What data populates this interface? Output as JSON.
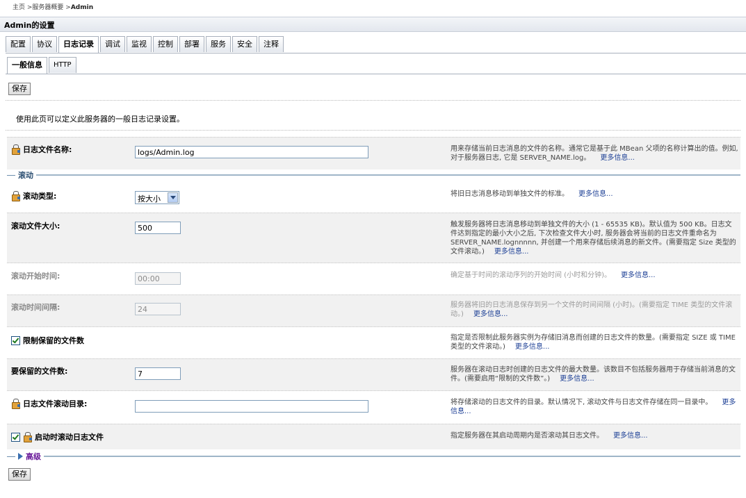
{
  "breadcrumb": {
    "home": "主页",
    "sep1": " >",
    "overview": "服务器概要",
    "sep2": " >",
    "current": "Admin"
  },
  "page_title": "Admin的设置",
  "tabs": [
    {
      "label": "配置",
      "active": false
    },
    {
      "label": "协议",
      "active": false
    },
    {
      "label": "日志记录",
      "active": true
    },
    {
      "label": "调试",
      "active": false
    },
    {
      "label": "监视",
      "active": false
    },
    {
      "label": "控制",
      "active": false
    },
    {
      "label": "部署",
      "active": false
    },
    {
      "label": "服务",
      "active": false
    },
    {
      "label": "安全",
      "active": false
    },
    {
      "label": "注释",
      "active": false
    }
  ],
  "subtabs": [
    {
      "label": "一般信息",
      "active": true
    },
    {
      "label": "HTTP",
      "active": false
    }
  ],
  "save_label": "保存",
  "intro": "使用此页可以定义此服务器的一般日志记录设置。",
  "more_info": "更多信息...",
  "fields": {
    "log_file_name": {
      "label": "日志文件名称:",
      "value": "logs/Admin.log",
      "help": "用来存储当前日志消息的文件的名称。通常它是基于此 MBean 父项的名称计算出的值。例如, 对于服务器日志, 它是 SERVER_NAME.log。"
    },
    "rotation_type": {
      "label": "滚动类型:",
      "value": "按大小",
      "help": "将旧日志消息移动到单独文件的标准。"
    },
    "rotation_file_size": {
      "label": "滚动文件大小:",
      "value": "500",
      "help": "触发服务器将日志消息移动到单独文件的大小 (1 - 65535 KB)。默认值为 500 KB。日志文件达到指定的最小大小之后, 下次检查文件大小时, 服务器会将当前的日志文件重命名为 SERVER_NAME.lognnnnn, 并创建一个用来存储后续消息的新文件。(需要指定 Size 类型的文件滚动。)"
    },
    "rotation_start_time": {
      "label": "滚动开始时间:",
      "value": "00:00",
      "help": "确定基于时间的滚动序列的开始时间 (小时和分钟)。"
    },
    "rotation_interval": {
      "label": "滚动时间间隔:",
      "value": "24",
      "help": "服务器将旧的日志消息保存到另一个文件的时间间隔 (小时)。(需要指定 TIME 类型的文件滚动。)"
    },
    "limit_retained_files": {
      "label": "限制保留的文件数",
      "checked": true,
      "help": "指定是否限制此服务器实例为存储旧消息而创建的日志文件的数量。(需要指定 SIZE 或 TIME 类型的文件滚动。)"
    },
    "files_to_retain": {
      "label": "要保留的文件数:",
      "value": "7",
      "help": "服务器在滚动日志时创建的日志文件的最大数量。该数目不包括服务器用于存储当前消息的文件。(需要启用“限制的文件数”。)"
    },
    "log_rotation_dir": {
      "label": "日志文件滚动目录:",
      "value": "",
      "help": "将存储滚动的日志文件的目录。默认情况下, 滚动文件与日志文件存储在同一目录中。"
    },
    "rotate_on_startup": {
      "label": "启动时滚动日志文件",
      "checked": true,
      "help": "指定服务器在其启动周期内是否滚动其日志文件。"
    }
  },
  "sections": {
    "rotation": "滚动",
    "advanced": "高级"
  },
  "colors": {
    "link": "#1c3f95",
    "section_line": "#9fb5c8",
    "lock_icon": "#e2a23a"
  }
}
